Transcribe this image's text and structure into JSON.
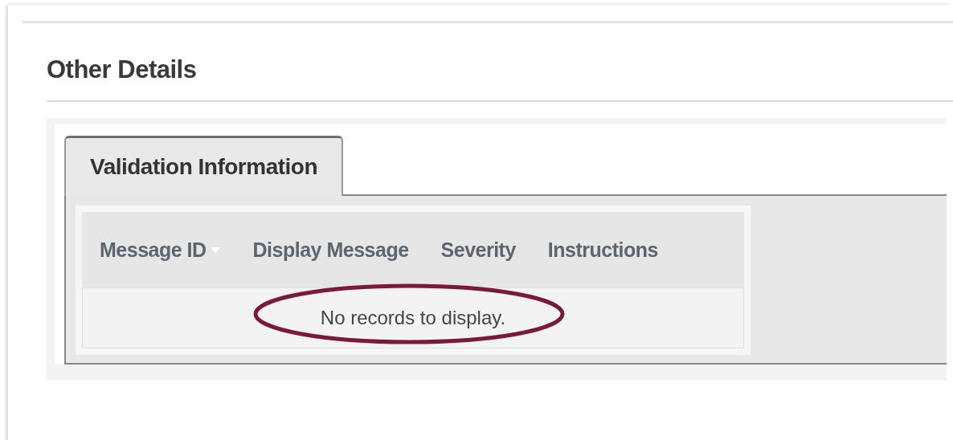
{
  "section": {
    "title": "Other Details"
  },
  "tabs": [
    {
      "label": "Validation Information",
      "selected": true
    }
  ],
  "grid": {
    "columns": [
      {
        "label": "Message ID",
        "sorted": true
      },
      {
        "label": "Display Message",
        "sorted": false
      },
      {
        "label": "Severity",
        "sorted": false
      },
      {
        "label": "Instructions",
        "sorted": false
      }
    ],
    "empty_message": "No records to display."
  },
  "annotation": {
    "kind": "ellipse"
  }
}
